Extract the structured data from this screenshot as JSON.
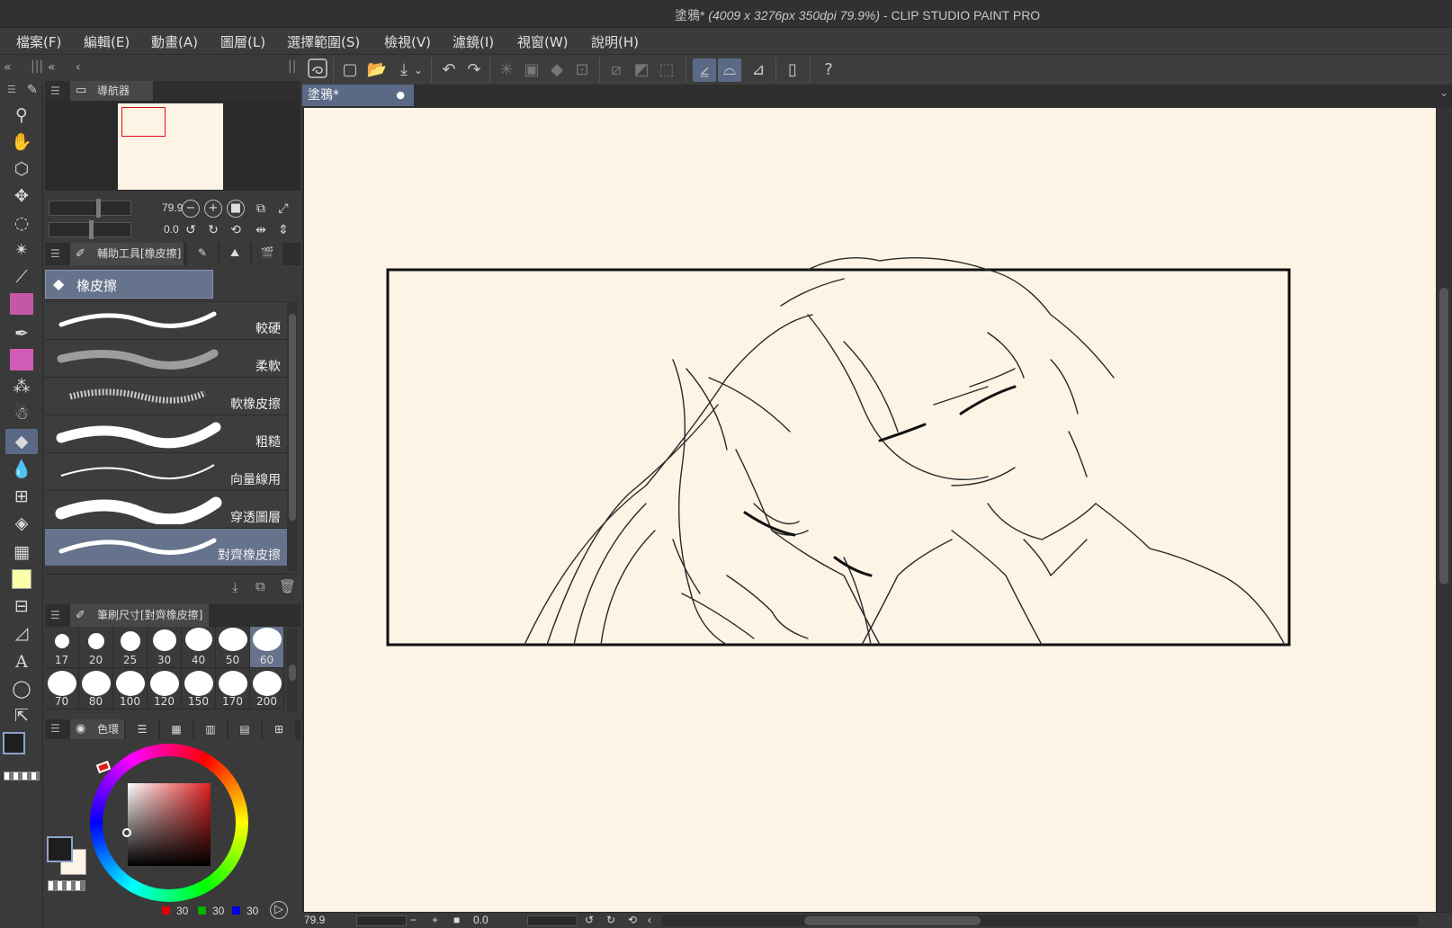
{
  "window": {
    "title_prefix": "塗鴉* ",
    "title_dims": "(4009 x 3276px 350dpi 79.9%)",
    "title_suffix": "  - CLIP STUDIO PAINT PRO"
  },
  "menu": [
    "檔案(F)",
    "編輯(E)",
    "動畫(A)",
    "圖層(L)",
    "選擇範圍(S)",
    "檢視(V)",
    "濾鏡(I)",
    "視窗(W)",
    "說明(H)"
  ],
  "navigator": {
    "tab": "導航器",
    "zoom": "79.9",
    "rotation": "0.0"
  },
  "subtool": {
    "tab": "輔助工具[橡皮擦]",
    "selected": "橡皮擦",
    "brushes": [
      "較硬",
      "柔軟",
      "軟橡皮擦",
      "粗糙",
      "向量線用",
      "穿透圖層",
      "對齊橡皮擦"
    ]
  },
  "brush_size": {
    "tab": "筆刷尺寸[對齊橡皮擦]",
    "sizes": [
      "17",
      "20",
      "25",
      "30",
      "40",
      "50",
      "60",
      "70",
      "80",
      "100",
      "120",
      "150",
      "170",
      "200"
    ],
    "selected": "60"
  },
  "color": {
    "tab": "色環",
    "r": "30",
    "g": "30",
    "b": "30",
    "main": "#1e1e1e",
    "sub": "#fdf4e6"
  },
  "canvas": {
    "doc_tab": "塗鴉*",
    "bg": "#fdf4e6"
  },
  "status": {
    "zoom": "79.9",
    "rotation": "0.0"
  }
}
